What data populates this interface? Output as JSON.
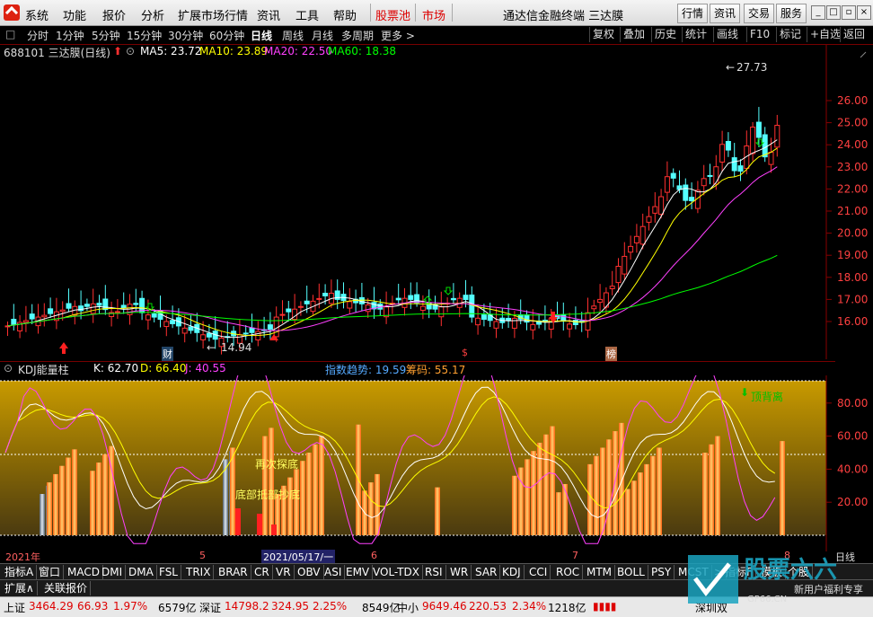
{
  "menu": {
    "items": [
      "系统",
      "功能",
      "报价",
      "分析",
      "扩展市场行情",
      "资讯",
      "工具",
      "帮助"
    ],
    "red_items": [
      "股票池",
      "市场"
    ],
    "title": "通达信金融终端 三达膜",
    "right_buttons": [
      "行情",
      "资讯",
      "交易",
      "服务"
    ]
  },
  "toolbar": {
    "periods": [
      "分时",
      "1分钟",
      "5分钟",
      "15分钟",
      "30分钟",
      "60分钟",
      "日线",
      "周线",
      "月线",
      "多周期",
      "更多 >"
    ],
    "active": "日线",
    "right": [
      "复权",
      "叠加",
      "历史",
      "统计",
      "画线",
      "F10",
      "标记",
      "+自选",
      "返回"
    ]
  },
  "info": {
    "code_name": "688101 三达膜(日线)",
    "ma5": "MA5: 23.72",
    "ma10": "MA10: 23.89",
    "ma20": "MA20: 22.50",
    "ma60": "MA60: 18.38",
    "high_label": "27.73",
    "low_label": "14.94",
    "marker_cai": "财",
    "marker_dollar": "$",
    "marker_bang": "榜"
  },
  "price_axis": [
    "26.00",
    "25.00",
    "24.00",
    "23.00",
    "22.00",
    "21.00",
    "20.00",
    "19.00",
    "18.00",
    "17.00",
    "16.00"
  ],
  "sub": {
    "name": "KDJ能量柱",
    "k": "K: 62.70",
    "d": "D: 66.40",
    "j": "J: 40.55",
    "trend": "指数趋势: 19.59",
    "chip": "筹码: 55.17",
    "axis": [
      "80.00",
      "60.00",
      "40.00",
      "20.00"
    ],
    "annot_top": "顶背离",
    "annot_again": "再次探底",
    "annot_bottom": "底部抵部抄底"
  },
  "dates": {
    "year": "2021年",
    "m5": "5",
    "current": "2021/05/17/一",
    "m6": "6",
    "m7": "7",
    "m8": "8",
    "period": "日线"
  },
  "tabs": [
    "指标A",
    "窗口",
    "MACD",
    "DMI",
    "DMA",
    "FSL",
    "TRIX",
    "BRAR",
    "CR",
    "VR",
    "OBV",
    "ASI",
    "EMV",
    "VOL-TDX",
    "RSI",
    "WR",
    "SAR",
    "KDJ",
    "CCI",
    "ROC",
    "MTM",
    "BOLL",
    "PSY",
    "MCST",
    ">",
    "指标F",
    "模板",
    "个股"
  ],
  "tabs2": [
    "扩展∧",
    "关联报价"
  ],
  "status": {
    "sh_label": "上证",
    "sh_val": "3464.29",
    "sh_chg": "66.93",
    "sh_pct": "1.97%",
    "sh_amt": "6579亿",
    "sz_label": "深证",
    "sz_val": "14798.2",
    "sz_chg": "324.95",
    "sz_pct": "2.25%",
    "sz_amt": "8549亿",
    "zx_label": "中小",
    "zx_val": "9649.46",
    "zx_chg": "220.53",
    "zx_pct": "2.34%",
    "zx_amt": "1218亿",
    "region": "深圳双"
  },
  "watermark": {
    "title": "股票六六",
    "sub": "新用户福利专享",
    "url": "GP66.CN"
  },
  "colors": {
    "up": "#ff3030",
    "down": "#54ffff",
    "ma5": "#ffffff",
    "ma10": "#ffff00",
    "ma20": "#ff40ff",
    "ma60": "#00ff00"
  }
}
